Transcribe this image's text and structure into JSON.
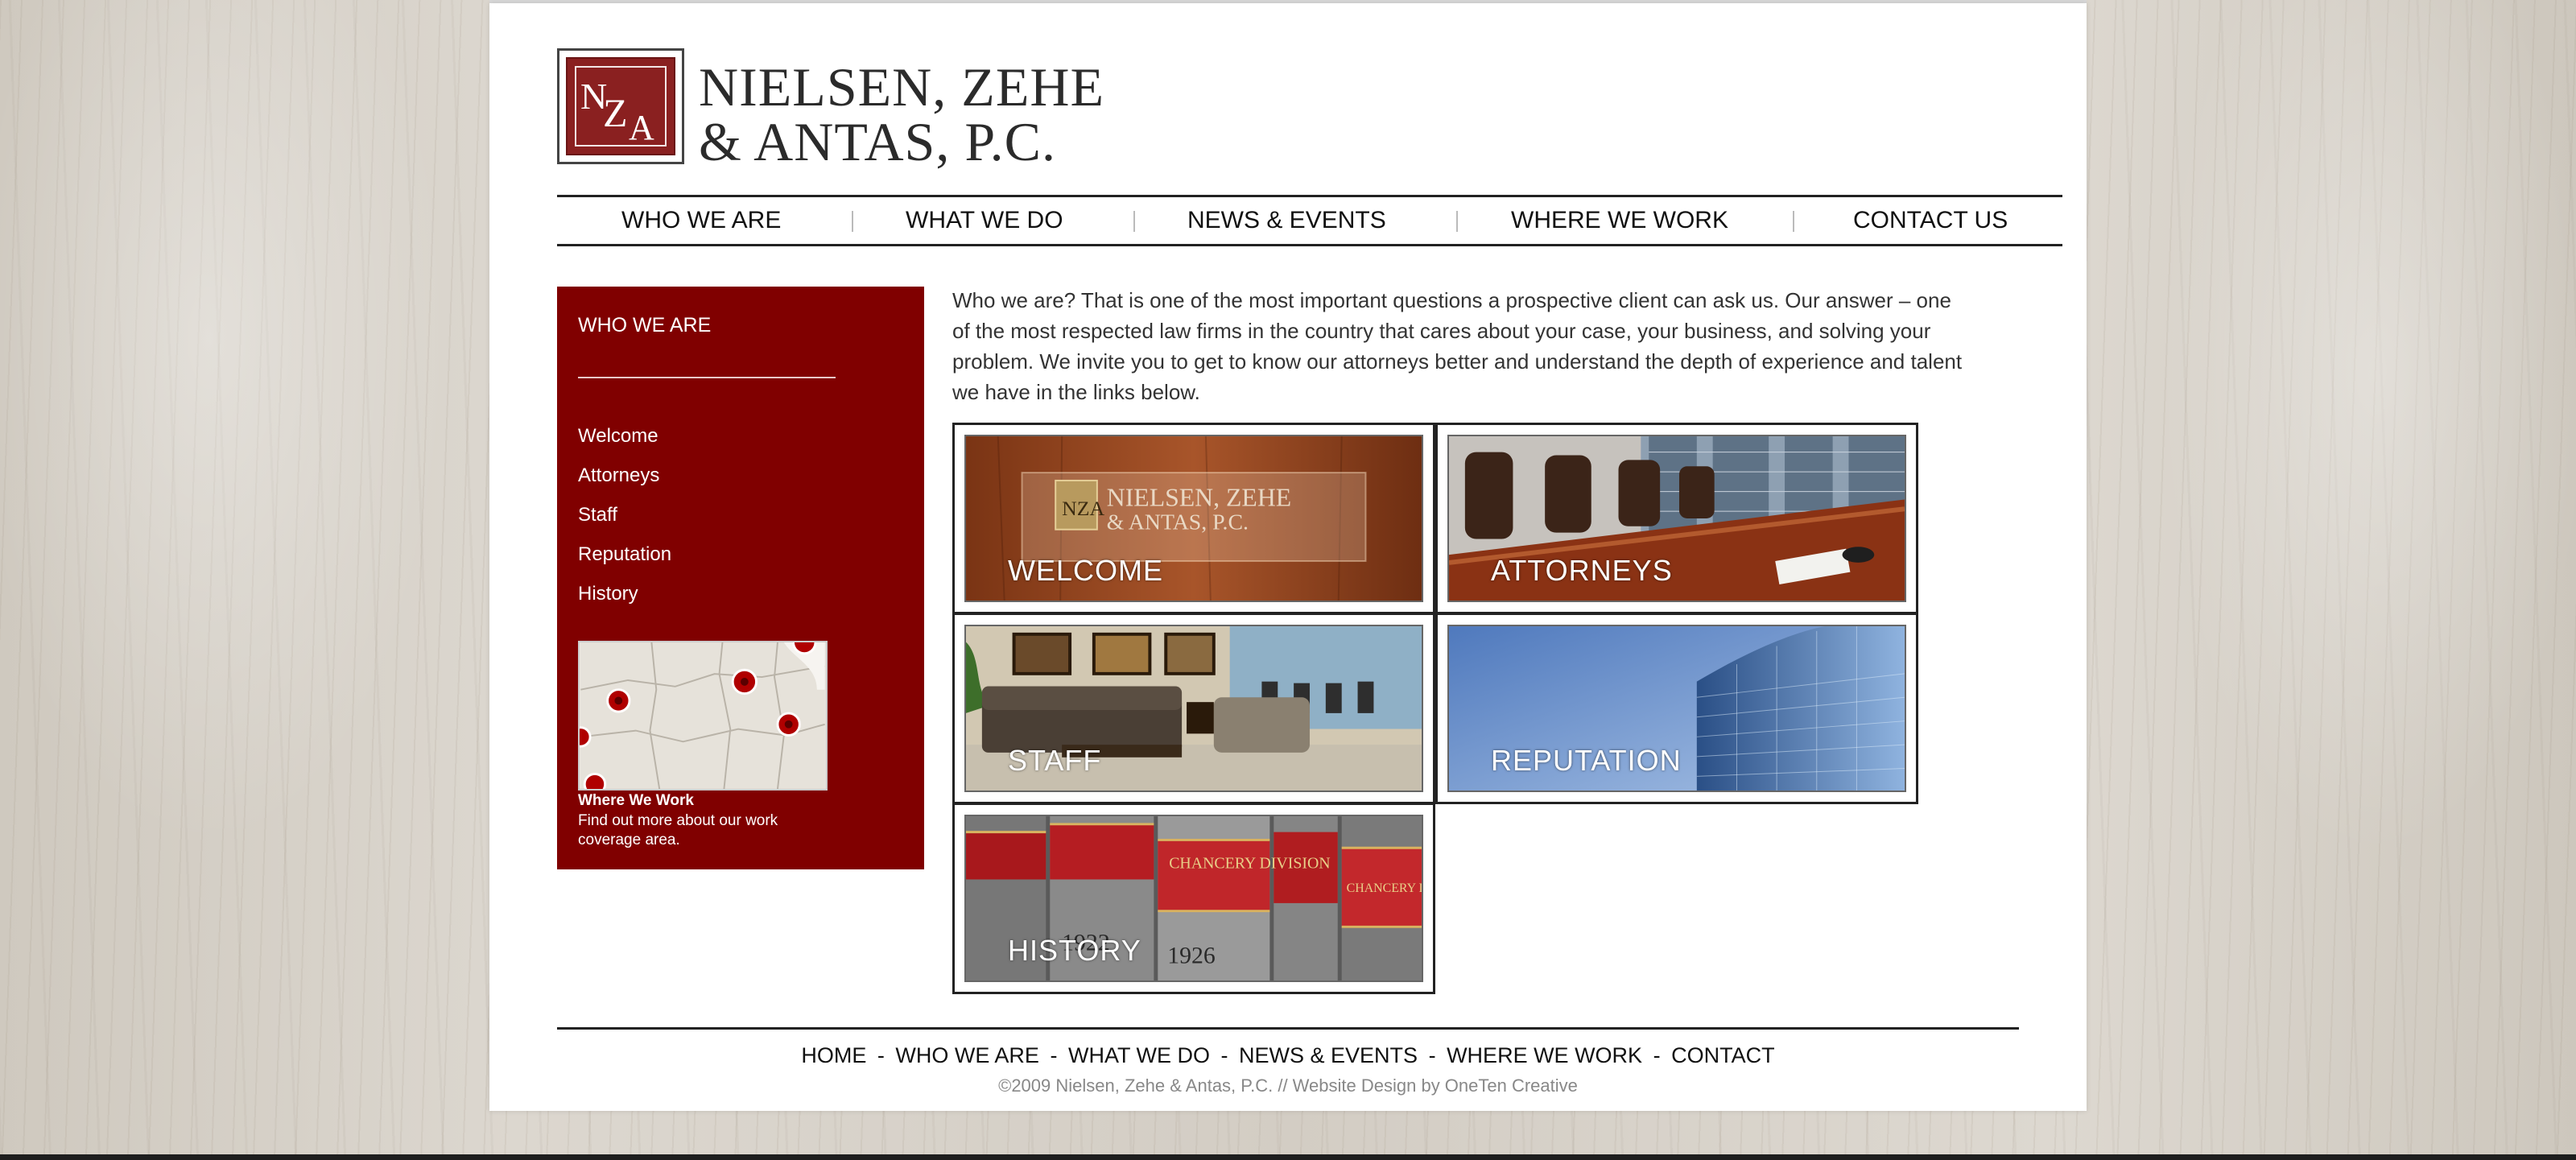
{
  "site": {
    "logo_monogram": "NZA",
    "logo_line1": "NIELSEN, ZEHE",
    "logo_line2": "& ANTAS, P.C."
  },
  "nav": {
    "items": [
      {
        "label": "WHO WE ARE"
      },
      {
        "label": "WHAT WE DO"
      },
      {
        "label": "NEWS & EVENTS"
      },
      {
        "label": "WHERE WE WORK"
      },
      {
        "label": "CONTACT US"
      }
    ]
  },
  "sidebar": {
    "title": "WHO WE ARE",
    "links": [
      {
        "label": "Welcome"
      },
      {
        "label": "Attorneys"
      },
      {
        "label": "Staff"
      },
      {
        "label": "Reputation"
      },
      {
        "label": "History"
      }
    ],
    "map_caption_title": "Where We Work",
    "map_caption_text": "Find out more about our work coverage area."
  },
  "main": {
    "intro": "Who we are? That is one of the most important questions a prospective client can ask us. Our answer – one of the most respected law firms in the country that cares about your case, your business, and solving your problem. We invite you to get to know our attorneys better and understand the depth of experience and talent we have in the links below.",
    "tiles": [
      {
        "label": "WELCOME",
        "sign_line1": "NIELSEN, ZEHE",
        "sign_line2": "& ANTAS, P.C."
      },
      {
        "label": "ATTORNEYS"
      },
      {
        "label": "STAFF"
      },
      {
        "label": "REPUTATION"
      },
      {
        "label": "HISTORY",
        "book_text1": "CHANCERY DIVISION",
        "book_text2": "CHANCERY DIVISION",
        "book_year1": "1922",
        "book_year2": "1926"
      }
    ]
  },
  "footer": {
    "links": [
      {
        "label": "HOME"
      },
      {
        "label": "WHO WE ARE"
      },
      {
        "label": "WHAT WE DO"
      },
      {
        "label": "NEWS & EVENTS"
      },
      {
        "label": "WHERE WE WORK"
      },
      {
        "label": "CONTACT"
      }
    ],
    "separator": "-",
    "copyright": "©2009 Nielsen, Zehe & Antas, P.C. // Website Design by OneTen Creative"
  },
  "colors": {
    "sidebar_bg": "#800000",
    "logo_red": "#8a2020",
    "text": "#333333"
  }
}
